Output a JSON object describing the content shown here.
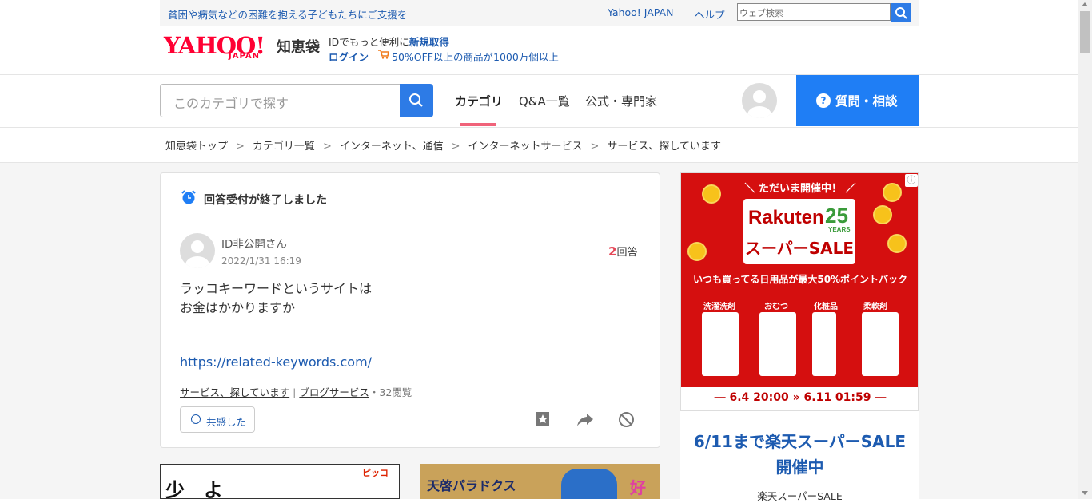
{
  "topbar": {
    "notice": "貧困や病気などの困難を抱える子どもたちにご支援を",
    "yahoo_japan": "Yahoo! JAPAN",
    "help": "ヘルプ",
    "search_placeholder": "ウェブ検索"
  },
  "header": {
    "logo_text": "YAHOO!",
    "logo_sub": "JAPAN",
    "logo_chiebukuro": "知恵袋",
    "id_line_prefix": "IDでもっと便利に",
    "id_line_link": "新規取得",
    "login": "ログイン",
    "promo": "50%OFF以上の商品が1000万個以上"
  },
  "nav": {
    "category_search_placeholder": "このカテゴリで探す",
    "tabs": [
      {
        "label": "カテゴリ",
        "active": true
      },
      {
        "label": "Q&A一覧"
      },
      {
        "label": "公式・専門家"
      }
    ],
    "ask_button": "質問・相談",
    "ask_icon": "?"
  },
  "breadcrumb": [
    "知恵袋トップ",
    "カテゴリ一覧",
    "インターネット、通信",
    "インターネットサービス",
    "サービス、探しています"
  ],
  "breadcrumb_sep": ">",
  "question": {
    "status": "回答受付が終了しました",
    "user": "ID非公開さん",
    "date": "2022/1/31 16:19",
    "answer_count": "2",
    "answer_label": "回答",
    "body_line1": "ラッコキーワードというサイトは",
    "body_line2": "お金はかかりますか",
    "link": "https://related-keywords.com/",
    "tags": [
      "サービス、探しています",
      "ブログサービス"
    ],
    "tag_sep": "|",
    "views": "・32閲覧",
    "empathy_button": "共感した"
  },
  "ad_right": {
    "banner_top": "＼ ただいま開催中！ ／",
    "brand": "Rakuten",
    "anniv": "25",
    "years": "YEARS",
    "sale": "スーパーSALE",
    "points": "いつも買ってる日用品が最大50%ポイントバック",
    "product_labels": [
      "洗濯洗剤",
      "おむつ",
      "化粧品",
      "柔軟剤"
    ],
    "dates": "― 6.4 20:00 » 6.11 01:59 ―",
    "info_icon": "ⓘ",
    "headline1": "6/11まで楽天スーパーSALE",
    "headline2": "開催中",
    "sub": "楽天スーパーSALE"
  },
  "ad_bottom_left": {
    "text": "少　よ",
    "logo": "ピッコ"
  },
  "ad_bottom_right": {
    "text": "天啓パラドクス",
    "char": "好"
  },
  "colors": {
    "accent_blue": "#1f7ef5",
    "link_blue": "#1d5bb0",
    "brand_red": "#ff0033",
    "tab_underline": "#f0637a",
    "answer_count_red": "#e54858"
  }
}
